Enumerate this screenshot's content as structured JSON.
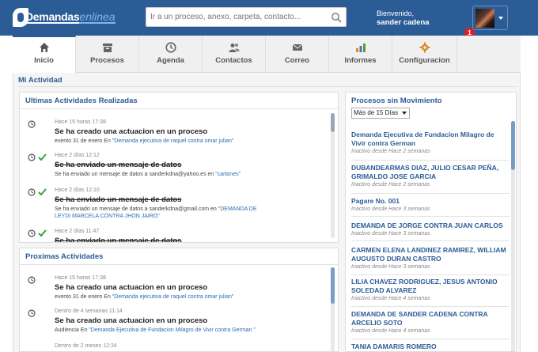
{
  "brand": {
    "part1": "Demandas",
    "part2": "enlinea"
  },
  "search": {
    "placeholder": "Ir a un proceso, anexo, carpeta, contacto..."
  },
  "user": {
    "greeting": "Bienvenido,",
    "name": "sander cadena",
    "notifications": "1"
  },
  "nav": {
    "tabs": [
      {
        "label": "Inicio",
        "icon": "home-icon"
      },
      {
        "label": "Procesos",
        "icon": "archive-icon"
      },
      {
        "label": "Agenda",
        "icon": "clock-icon"
      },
      {
        "label": "Contactos",
        "icon": "contacts-icon"
      },
      {
        "label": "Correo",
        "icon": "mail-icon"
      },
      {
        "label": "Informes",
        "icon": "chart-icon"
      },
      {
        "label": "Configuracion",
        "icon": "gear-icon"
      }
    ]
  },
  "page": {
    "title": "Mi Actividad"
  },
  "ultimas": {
    "title": "Ultimas Actividades Realizadas",
    "items": [
      {
        "meta": "Hace 15 horas 17:38",
        "title": "Se ha creado una actuacion en un proceso",
        "desc": "evento 31 de enero En ",
        "link": "\"Demanda ejecutiva de raquel contra omar julian\""
      },
      {
        "meta": "Hace 2 días 12:12",
        "title": "Se ha enviado un mensaje de datos",
        "desc": "Se ha enviado un mensaje de datos a sanderkdna@yahoo.es en ",
        "link": "\"cartones\""
      },
      {
        "meta": "Hace 2 días 12:10",
        "title": "Se ha enviado un mensaje de datos",
        "desc": "Se ha enviado un mensaje de datos a sanderkdna@gmail.com en ",
        "link": "\"DEMANDA DE LEYDI MARCELA CONTRA JHON JAIRO\""
      },
      {
        "meta": "Hace 2 días 11:47",
        "title": "Se ha enviado un mensaje de datos",
        "desc": "",
        "link": ""
      }
    ]
  },
  "proximas": {
    "title": "Proximas Actividades",
    "items": [
      {
        "meta": "Hace 15 horas 17:38",
        "title": "Se ha creado una actuacion en un proceso",
        "desc": "evento 31 de enero En ",
        "link": "\"Demanda ejecutiva de raquel contra omar julian\""
      },
      {
        "meta": "Dentro de 4 semanas 11:14",
        "title": "Se ha creado una actuacion en un proceso",
        "desc": "Audiencia En ",
        "link": "\"Demanda Ejecutiva de Fundacion Milagro de Vivir contra German \""
      },
      {
        "meta": "Dentro de 2 meses 12:34",
        "title": "",
        "desc": "",
        "link": ""
      }
    ]
  },
  "procesos": {
    "title": "Procesos sin Movimiento",
    "filter": "Más de 15 Días",
    "items": [
      {
        "name": "Demanda Ejecutiva de Fundacion Milagro de Vivir contra German",
        "inactive": "Inactivo desde Hace 2 semanas"
      },
      {
        "name": "DUBANDEARMAS DIAZ, JULIO CESAR PEÑA, GRIMALDO JOSE GARCIA",
        "inactive": "Inactivo desde Hace 2 semanas"
      },
      {
        "name": "Pagare No. 001",
        "inactive": "Inactivo desde Hace 3 semanas"
      },
      {
        "name": "DEMANDA DE JORGE CONTRA JUAN CARLOS",
        "inactive": "Inactivo desde Hace 3 semanas"
      },
      {
        "name": "CARMEN ELENA LANDINEZ RAMIREZ, WILLIAM AUGUSTO DURAN CASTRO",
        "inactive": "Inactivo desde Hace 3 semanas"
      },
      {
        "name": "LILIA CHAVEZ RODRIGUEZ, JESUS ANTONIO SOLEDAD ALVAREZ",
        "inactive": "Inactivo desde Hace 4 semanas"
      },
      {
        "name": "DEMANDA DE SANDER CADENA CONTRA ARCELIO SOTO",
        "inactive": "Inactivo desde Hace 4 semanas"
      },
      {
        "name": "TANIA DAMARIS ROMERO",
        "inactive": ""
      }
    ]
  }
}
